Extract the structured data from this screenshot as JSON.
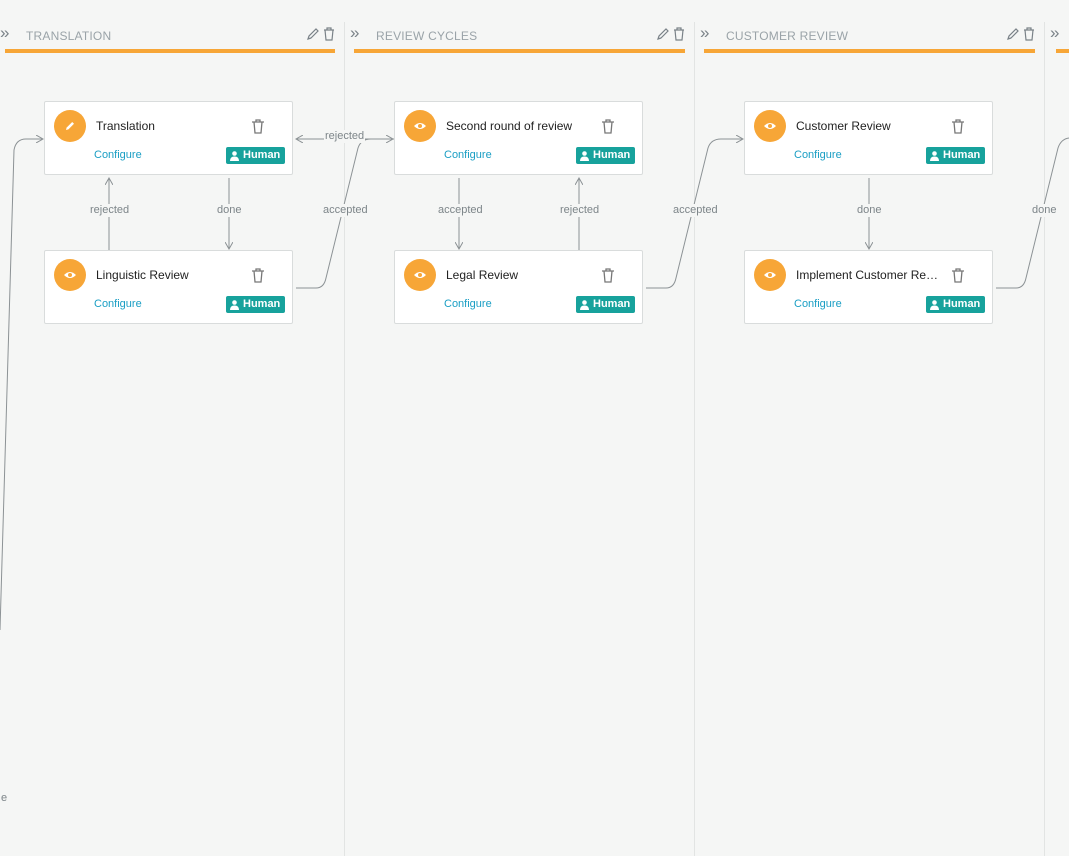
{
  "columns": [
    {
      "title": "TRANSLATION"
    },
    {
      "title": "REVIEW CYCLES"
    },
    {
      "title": "CUSTOMER REVIEW"
    },
    {
      "title": ""
    }
  ],
  "header_icons": {
    "collapse": "chevron-double-right-icon",
    "edit": "pencil-icon",
    "delete": "trash-icon"
  },
  "cards": [
    {
      "name": "Translation",
      "icon": "pencil-icon",
      "configure": "Configure",
      "role": "Human"
    },
    {
      "name": "Linguistic Review",
      "icon": "eye-icon",
      "configure": "Configure",
      "role": "Human"
    },
    {
      "name": "Second round of review",
      "icon": "eye-icon",
      "configure": "Configure",
      "role": "Human"
    },
    {
      "name": "Legal Review",
      "icon": "eye-icon",
      "configure": "Configure",
      "role": "Human"
    },
    {
      "name": "Customer Review",
      "icon": "eye-icon",
      "configure": "Configure",
      "role": "Human"
    },
    {
      "name": "Implement Customer Review",
      "icon": "eye-icon",
      "configure": "Configure",
      "role": "Human"
    }
  ],
  "edge_labels": {
    "translation_rejected": "rejected",
    "translation_done": "done",
    "linguistic_accepted": "accepted",
    "second_rejected": "rejected",
    "second_accepted": "accepted",
    "legal_rejected": "rejected",
    "legal_accepted": "accepted",
    "customer_done": "done",
    "implement_done": "done",
    "partial_left": "e"
  },
  "colors": {
    "accent": "#f7a637",
    "role_badge": "#17a29c",
    "link": "#1a9ec4",
    "edge": "#8c9295"
  }
}
